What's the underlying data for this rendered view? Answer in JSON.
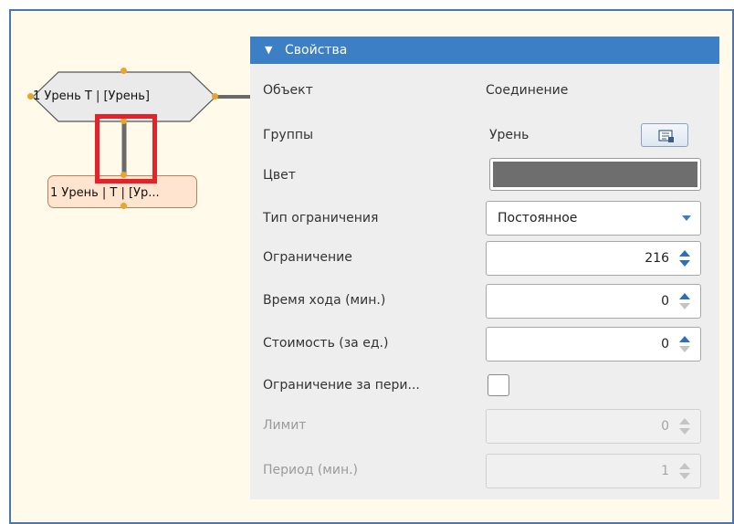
{
  "diagram": {
    "top_node_label": "1 Урень Т | [Урень]",
    "bottom_node_label": "1 Урень | Т | [Ур..."
  },
  "panel": {
    "header_title": "Свойства",
    "object_label": "Объект",
    "object_value": "Соединение",
    "groups_label": "Группы",
    "groups_value": "Урень",
    "color_label": "Цвет",
    "color_value": "#6e6e6e",
    "constraint_type_label": "Тип ограничения",
    "constraint_type_value": "Постоянное",
    "constraint_label": "Ограничение",
    "constraint_value": "216",
    "travel_time_label": "Время хода (мин.)",
    "travel_time_value": "0",
    "cost_label": "Стоимость (за ед.)",
    "cost_value": "0",
    "period_constraint_label": "Ограничение за пери...",
    "limit_label": "Лимит",
    "limit_value": "0",
    "period_label": "Период (мин.)",
    "period_value": "1"
  },
  "colors": {
    "accent": "#3d7fc4",
    "frame_border": "#4a77b4",
    "canvas_bg": "#fffaea",
    "highlight": "#e5212a",
    "node_fill": "#ffe4cf"
  }
}
